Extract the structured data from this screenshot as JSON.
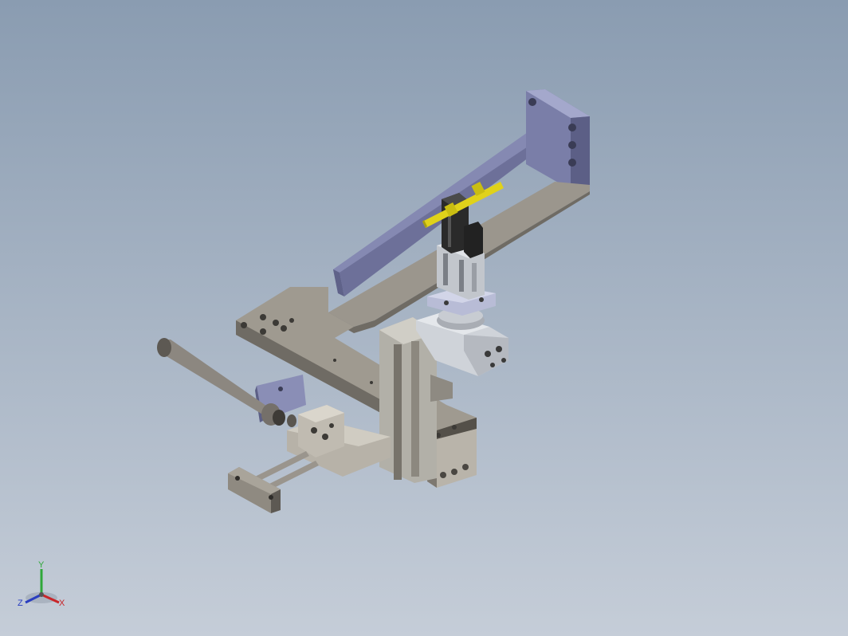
{
  "viewport": {
    "background_top": "#8a9cb1",
    "background_bottom": "#c5cdd8"
  },
  "model": {
    "colors": {
      "plate_top": "#9b968d",
      "plate_side": "#6f6b64",
      "plate_dark": "#545049",
      "bracket": "#7a7ea8",
      "bracket_light": "#9fa3c8",
      "steel": "#d4d8de",
      "rod": "#8c8780",
      "cylinder_dark": "#2a2a2a",
      "fitting_yellow": "#e0d21a"
    }
  },
  "triad": {
    "x_label": "X",
    "y_label": "Y",
    "z_label": "Z",
    "x_color": "#c8262a",
    "y_color": "#2fa83a",
    "z_color": "#2a3ec0"
  }
}
